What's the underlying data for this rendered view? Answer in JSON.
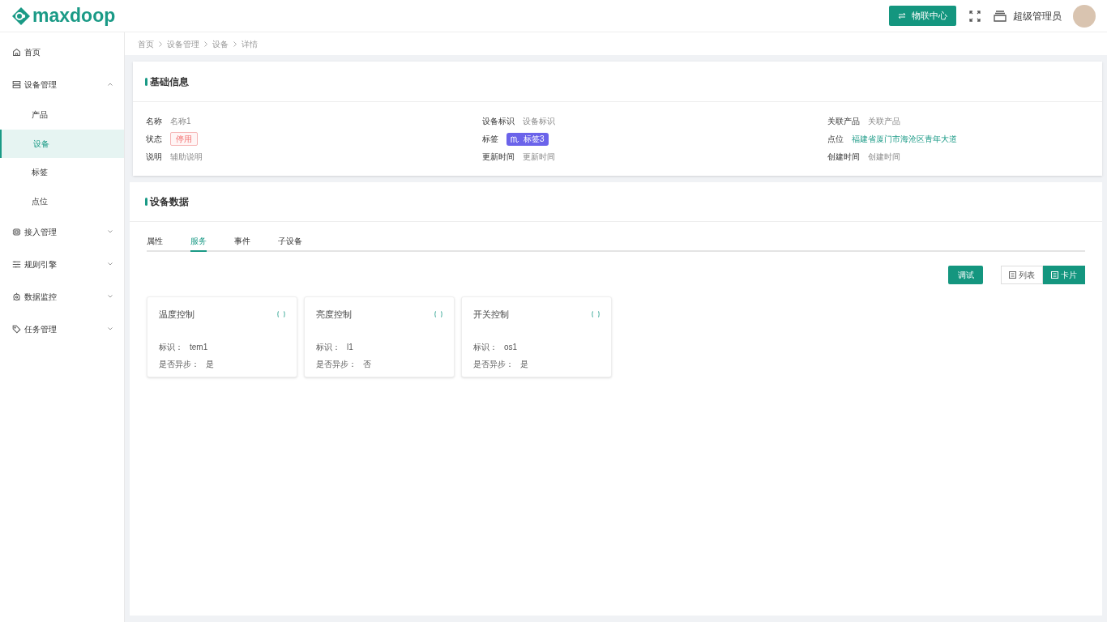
{
  "header": {
    "logo": "maxdoop",
    "iot_button": "物联中心",
    "user": "超级管理员"
  },
  "sidebar": {
    "items": [
      {
        "label": "首页",
        "selected": false
      },
      {
        "label": "设备管理",
        "expanded": true,
        "selected": false,
        "children": [
          {
            "label": "产品",
            "selected": false
          },
          {
            "label": "设备",
            "selected": true
          },
          {
            "label": "标签",
            "selected": false
          },
          {
            "label": "点位",
            "selected": false
          }
        ]
      },
      {
        "label": "接入管理",
        "expanded": false,
        "selected": false
      },
      {
        "label": "规则引擎",
        "expanded": false,
        "selected": false
      },
      {
        "label": "数据监控",
        "expanded": false,
        "selected": false
      },
      {
        "label": "任务管理",
        "expanded": false,
        "selected": false
      }
    ]
  },
  "breadcrumb": [
    "首页",
    "设备管理",
    "设备",
    "详情"
  ],
  "basic_info": {
    "title": "基础信息",
    "columns": [
      [
        {
          "label": "名称",
          "value": "名称1",
          "kind": "text"
        },
        {
          "label": "状态",
          "value": "停用",
          "kind": "badge"
        },
        {
          "label": "说明",
          "value": "辅助说明",
          "kind": "text"
        }
      ],
      [
        {
          "label": "设备标识",
          "value": "设备标识",
          "kind": "text"
        },
        {
          "label": "标签",
          "value": "标签3",
          "kind": "tag"
        },
        {
          "label": "更新时间",
          "value": "更新时间",
          "kind": "text"
        }
      ],
      [
        {
          "label": "关联产品",
          "value": "关联产品",
          "kind": "text"
        },
        {
          "label": "点位",
          "value": "福建省厦门市海沧区青年大道",
          "kind": "link"
        },
        {
          "label": "创建时间",
          "value": "创建时间",
          "kind": "text"
        }
      ]
    ]
  },
  "device_data": {
    "title": "设备数据",
    "tabs": [
      {
        "label": "属性",
        "selected": false
      },
      {
        "label": "服务",
        "selected": true
      },
      {
        "label": "事件",
        "selected": false
      },
      {
        "label": "子设备",
        "selected": false
      }
    ],
    "debug_button": "调试",
    "view_toggle": [
      {
        "label": "列表",
        "selected": false
      },
      {
        "label": "卡片",
        "selected": true
      }
    ],
    "cards": [
      {
        "title": "温度控制",
        "id_label": "标识：",
        "id": "tem1",
        "async_label": "是否异步：",
        "async": "是"
      },
      {
        "title": "亮度控制",
        "id_label": "标识：",
        "id": "l1",
        "async_label": "是否异步：",
        "async": "否"
      },
      {
        "title": "开关控制",
        "id_label": "标识：",
        "id": "os1",
        "async_label": "是否异步：",
        "async": "是"
      }
    ]
  }
}
